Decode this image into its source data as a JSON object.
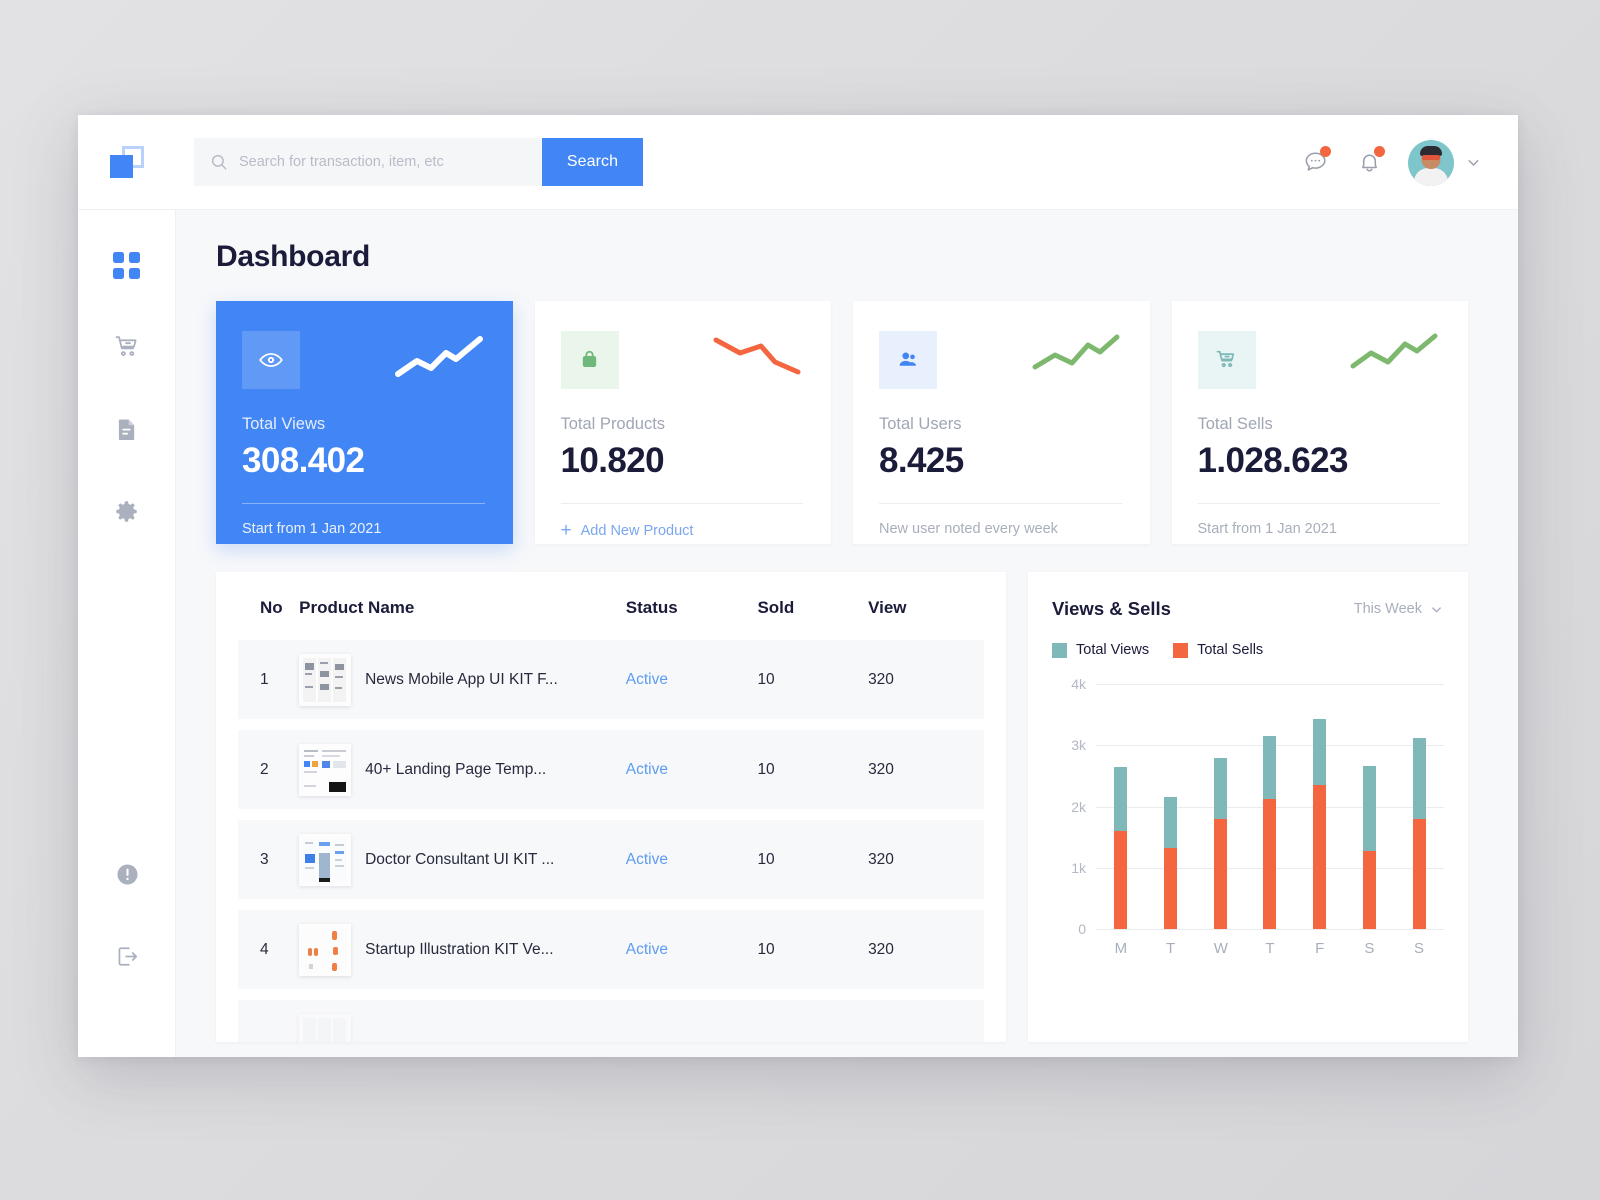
{
  "topbar": {
    "logo_name": "app-logo",
    "search": {
      "placeholder": "Search for transaction, item, etc",
      "value": "",
      "button_label": "Search"
    },
    "messages_icon": "chat-bubble-icon",
    "notifications_icon": "bell-icon",
    "profile_chevron": "chevron-down-icon"
  },
  "sidebar": {
    "items": [
      {
        "name": "dashboard",
        "icon": "grid-icon",
        "active": true
      },
      {
        "name": "orders",
        "icon": "shopping-cart-icon",
        "active": false
      },
      {
        "name": "documents",
        "icon": "document-icon",
        "active": false
      },
      {
        "name": "settings",
        "icon": "gear-icon",
        "active": false
      }
    ],
    "bottom_items": [
      {
        "name": "help",
        "icon": "info-circle-icon"
      },
      {
        "name": "logout",
        "icon": "logout-icon"
      }
    ]
  },
  "page": {
    "title": "Dashboard"
  },
  "stats": [
    {
      "label": "Total Views",
      "value": "308.402",
      "footer": "Start from 1 Jan 2021",
      "icon": "eye-icon",
      "trend": "up",
      "accent": "#4285f4",
      "primary": true
    },
    {
      "label": "Total Products",
      "value": "10.820",
      "footer": "Add New Product",
      "footer_is_link": true,
      "icon": "bag-icon",
      "trend": "down",
      "accent": "#f4663f",
      "primary": false
    },
    {
      "label": "Total Users",
      "value": "8.425",
      "footer": "New user noted every week",
      "icon": "users-icon",
      "trend": "up",
      "accent": "#7eb86f",
      "primary": false
    },
    {
      "label": "Total Sells",
      "value": "1.028.623",
      "footer": "Start from 1 Jan 2021",
      "icon": "shopping-cart-icon",
      "trend": "up",
      "accent": "#7eb86f",
      "primary": false
    }
  ],
  "table": {
    "columns": [
      "No",
      "Product Name",
      "Status",
      "Sold",
      "View"
    ],
    "rows": [
      {
        "no": "1",
        "name": "News Mobile App UI KIT F...",
        "status": "Active",
        "sold": "10",
        "view": "320",
        "thumb": "t1"
      },
      {
        "no": "2",
        "name": "40+ Landing Page Temp...",
        "status": "Active",
        "sold": "10",
        "view": "320",
        "thumb": "t2"
      },
      {
        "no": "3",
        "name": "Doctor Consultant UI KIT ...",
        "status": "Active",
        "sold": "10",
        "view": "320",
        "thumb": "t3"
      },
      {
        "no": "4",
        "name": "Startup Illustration KIT Ve...",
        "status": "Active",
        "sold": "10",
        "view": "320",
        "thumb": "t4"
      }
    ]
  },
  "chart_panel": {
    "title": "Views & Sells",
    "range_label": "This Week",
    "range_chevron": "chevron-down-icon",
    "legend": [
      {
        "label": "Total Views",
        "color": "#7fb8b8"
      },
      {
        "label": "Total Sells",
        "color": "#f4663f"
      }
    ]
  },
  "chart_data": {
    "type": "bar",
    "stacked": true,
    "title": "Views & Sells",
    "xlabel": "",
    "ylabel": "",
    "categories": [
      "M",
      "T",
      "W",
      "T",
      "F",
      "S",
      "S"
    ],
    "tick_labels": [
      "0",
      "1k",
      "2k",
      "3k",
      "4k"
    ],
    "ylim": [
      0,
      4000
    ],
    "grid": true,
    "legend_position": "top-left",
    "series": [
      {
        "name": "Total Sells",
        "color": "#f4663f",
        "values": [
          1600,
          1330,
          1800,
          2130,
          2350,
          1280,
          1800
        ]
      },
      {
        "name": "Total Views",
        "color": "#7fb8b8",
        "values": [
          1050,
          830,
          1000,
          1020,
          1080,
          1380,
          1320
        ]
      }
    ],
    "totals": [
      2650,
      2160,
      2800,
      3150,
      3430,
      2660,
      3120
    ]
  }
}
